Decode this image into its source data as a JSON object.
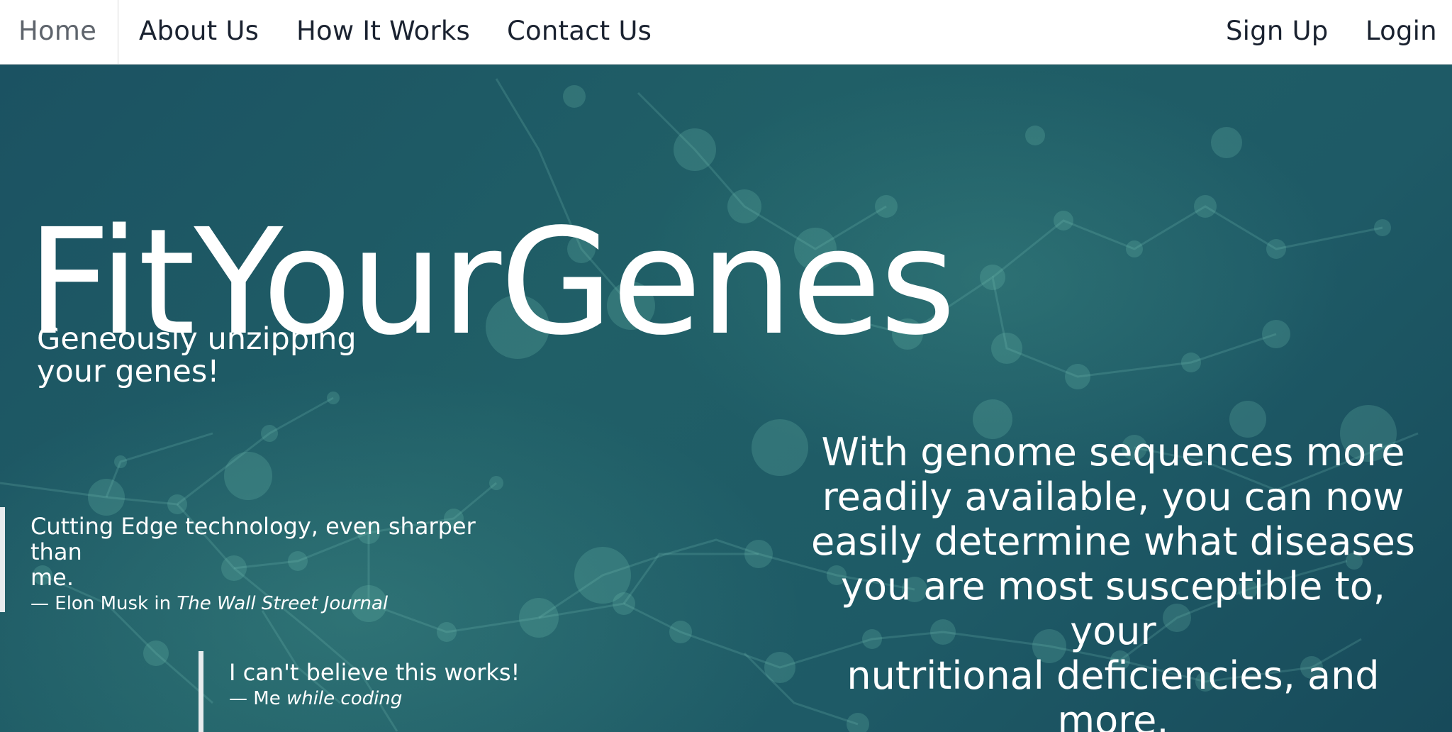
{
  "nav": {
    "left": [
      {
        "label": "Home",
        "active": true
      },
      {
        "label": "About Us",
        "active": false
      },
      {
        "label": "How It Works",
        "active": false
      },
      {
        "label": "Contact Us",
        "active": false
      }
    ],
    "right": [
      {
        "label": "Sign Up"
      },
      {
        "label": "Login"
      }
    ]
  },
  "hero": {
    "brand": "FitYourGenes",
    "tagline_line1": "Geneously unzipping",
    "tagline_line2": "your genes!",
    "intro_lines": [
      "With genome sequences more",
      "readily available, you can now",
      "easily determine what diseases",
      "you are most susceptible to, your",
      "nutritional deficiencies, and more."
    ]
  },
  "quotes": [
    {
      "text_line1": "Cutting Edge technology, even sharper than",
      "text_line2": "me.",
      "dash": "—",
      "author": "Elon Musk in",
      "source": "The Wall Street Journal"
    },
    {
      "text_line1": "I can't believe this works!",
      "dash": "—",
      "author": "Me",
      "source": "while coding"
    }
  ],
  "colors": {
    "background": "#1d5560",
    "navbar": "#ffffff",
    "nav_text": "#1a2230",
    "nav_active_text": "#5e646c",
    "hero_text": "#ffffff",
    "quote_border": "#e8ecee"
  }
}
